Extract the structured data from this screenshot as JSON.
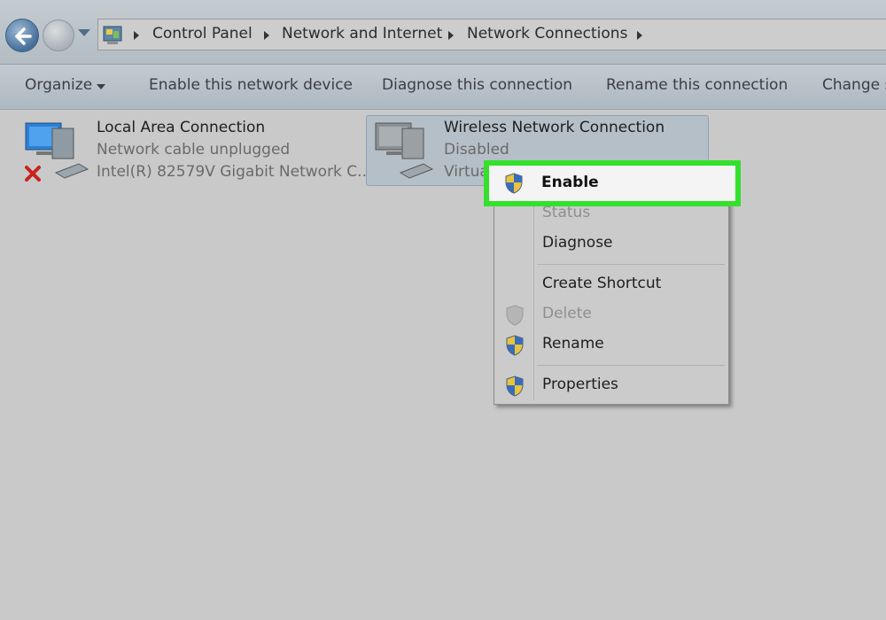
{
  "breadcrumb": [
    "Control Panel",
    "Network and Internet",
    "Network Connections"
  ],
  "toolbar": {
    "organize": "Organize",
    "enable_device": "Enable this network device",
    "diagnose": "Diagnose this connection",
    "rename": "Rename this connection",
    "change": "Change s"
  },
  "connections": [
    {
      "name": "Local Area Connection",
      "status": "Network cable unplugged",
      "device": "Intel(R) 82579V Gigabit Network C..."
    },
    {
      "name": "Wireless Network Connection",
      "status": "Disabled",
      "device": "Virtua"
    }
  ],
  "context_menu": {
    "enable": "Enable",
    "status": "Status",
    "diagnose": "Diagnose",
    "create_shortcut": "Create Shortcut",
    "delete": "Delete",
    "rename": "Rename",
    "properties": "Properties"
  },
  "colors": {
    "highlight": "#33e12c"
  }
}
